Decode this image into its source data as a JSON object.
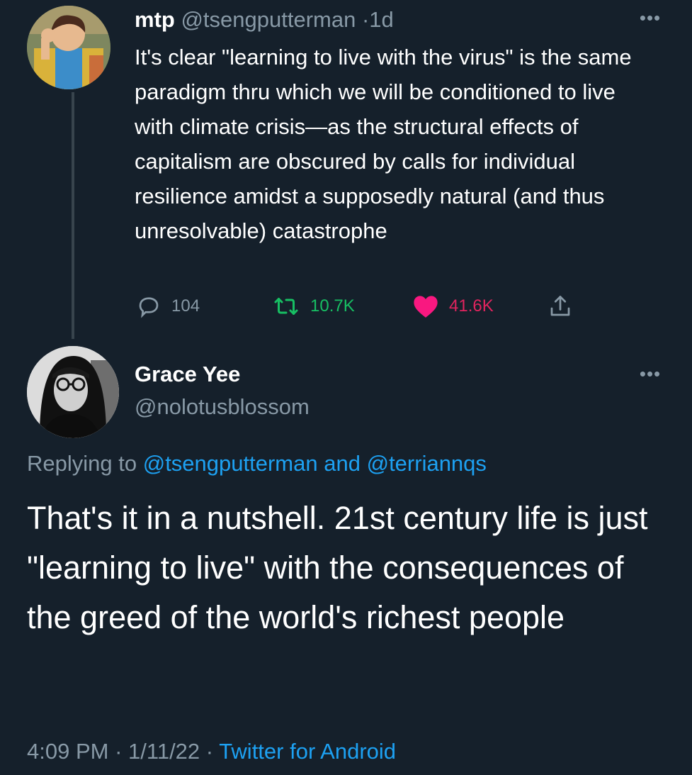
{
  "parent_tweet": {
    "display_name": "mtp",
    "handle": "@tsengputterman",
    "separator": "·",
    "age": "1d",
    "text": "It's clear \"learning to live with the virus\" is the same paradigm thru which we will be conditioned to live with climate crisis—as the structural effects of capitalism are obscured by calls for individual resilience amidst a supposedly natural (and thus unresolvable) catastrophe",
    "more_icon": "more-horizontal-icon",
    "actions": {
      "replies": "104",
      "retweets": "10.7K",
      "likes": "41.6K",
      "reply_icon": "comment-bubble-icon",
      "retweet_icon": "retweet-icon",
      "like_icon": "heart-icon",
      "share_icon": "share-icon"
    },
    "colors": {
      "retweet": "#17bf63",
      "like": "#e0245e"
    }
  },
  "reply_tweet": {
    "display_name": "Grace Yee",
    "handle": "@nolotusblossom",
    "more_icon": "more-horizontal-icon",
    "replying_prefix": "Replying to",
    "replying_user1": "@tsengputterman",
    "replying_and": "and",
    "replying_user2": "@terriannqs",
    "text": "That's it in a nutshell. 21st century life is just \"learning to live\" with the consequences of the greed of the world's richest people",
    "time": "4:09 PM",
    "sep1": "·",
    "date": "1/11/22",
    "sep2": "·",
    "source": "Twitter for Android"
  },
  "theme": {
    "background": "#15202b",
    "secondary_text": "#8899a6",
    "link": "#1da1f2"
  }
}
